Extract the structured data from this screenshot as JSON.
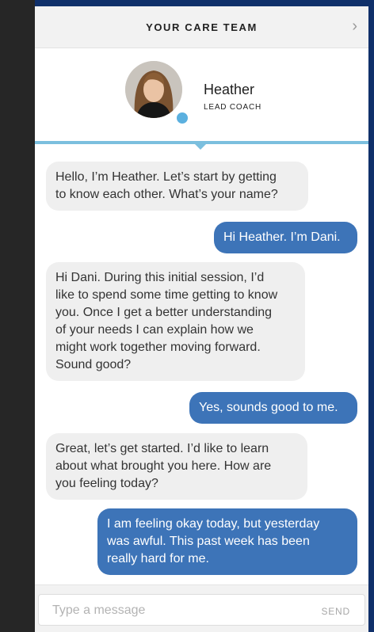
{
  "header": {
    "title": "YOUR CARE TEAM"
  },
  "coach": {
    "name": "Heather",
    "role": "LEAD COACH"
  },
  "messages": [
    {
      "from": "coach",
      "text": "Hello, I’m Heather. Let’s start by getting\nto know each other. What’s your name?"
    },
    {
      "from": "user",
      "text": "Hi Heather. I’m Dani."
    },
    {
      "from": "coach",
      "text": "Hi Dani. During this initial session, I’d\nlike to spend some time getting to know\nyou. Once I get a better understanding\nof your needs I can explain how we\nmight work together moving forward.\nSound good?"
    },
    {
      "from": "user",
      "text": "Yes, sounds good to me."
    },
    {
      "from": "coach",
      "text": "Great, let’s get started. I’d like to learn\nabout what brought you here. How are\nyou feeling today?"
    },
    {
      "from": "user",
      "text": "I am feeling okay today, but yesterday\nwas awful. This past week has been\nreally hard for me."
    }
  ],
  "composer": {
    "placeholder": "Type a message",
    "send_label": "SEND"
  },
  "colors": {
    "outgoing": "#3d74b8",
    "incoming": "#efefef",
    "accent": "#7bbfde",
    "frame": "#10306a"
  },
  "icons": {
    "next": "chevron-right-icon",
    "presence": "online-status-icon"
  }
}
